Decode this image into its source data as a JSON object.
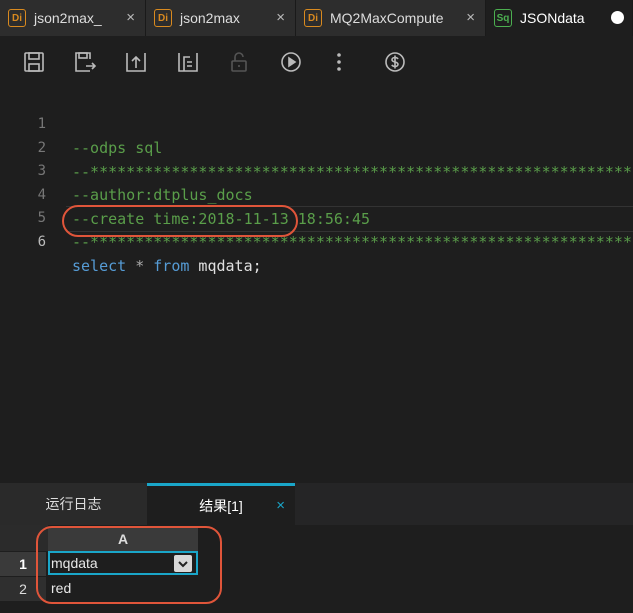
{
  "tabs": [
    {
      "badge": "Di",
      "title": "json2max_",
      "close": "×"
    },
    {
      "badge": "Di",
      "title": "json2max",
      "close": "×"
    },
    {
      "badge": "Di",
      "title": "MQ2MaxCompute",
      "close": "×"
    },
    {
      "badge": "Sq",
      "title": "JSONdata"
    }
  ],
  "toolbar": {
    "icons": [
      "save-icon",
      "save-as-icon",
      "submit-icon",
      "steal-lock-icon",
      "lock-icon",
      "run-icon",
      "more-icon",
      "cost-estimate-icon"
    ]
  },
  "editor": {
    "line_numbers": [
      "1",
      "2",
      "3",
      "4",
      "5",
      "6"
    ],
    "lines": {
      "l1": "--odps sql",
      "l2": "--********************************************************************--",
      "l3": "--author:dtplus_docs",
      "l4": "--create time:2018-11-13 18:56:45",
      "l5": "--********************************************************************--",
      "l6": {
        "kw1": "select",
        "op": " * ",
        "kw2": "from",
        "rest": " mqdata;"
      }
    }
  },
  "panel": {
    "tabs": [
      {
        "label": "运行日志"
      },
      {
        "label": "结果[1]",
        "close": "×"
      }
    ]
  },
  "results": {
    "column": "A",
    "row_numbers": [
      "1",
      "2"
    ],
    "cells": [
      "mqdata",
      "red"
    ]
  },
  "colors": {
    "accent": "#1aa6c9",
    "highlight": "#e0553a",
    "comment": "#5a9e4a",
    "keyword": "#569cd6"
  }
}
